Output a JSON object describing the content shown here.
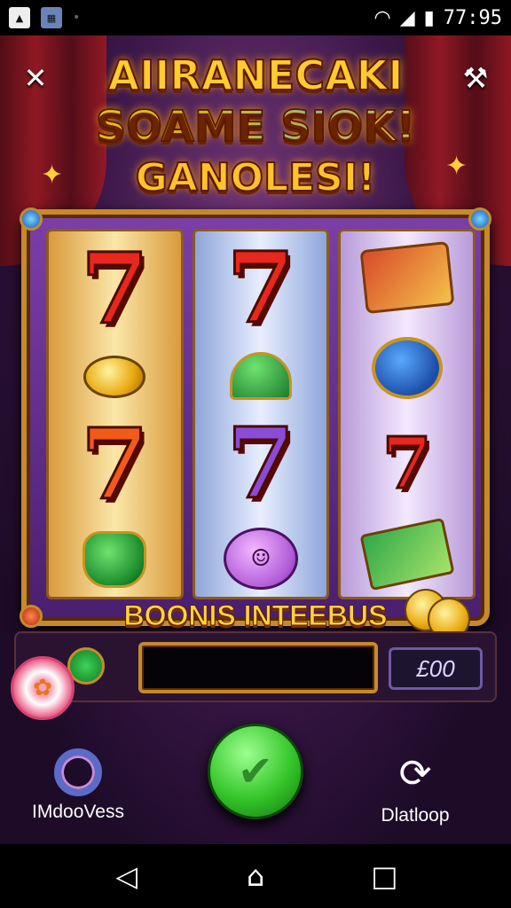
{
  "status_bar": {
    "time": "77:95",
    "left_icons": [
      "photo-icon",
      "gallery-icon"
    ],
    "right_icons": [
      "wifi-icon",
      "signal-icon",
      "battery-icon"
    ]
  },
  "game": {
    "title_lines": [
      "AIIRANECAKI",
      "SOAME SIOK!",
      "GANOLESI!"
    ],
    "bonus_label": "BOONIS INTEEBUS",
    "credit_display": "£00",
    "bet_bar_value": "",
    "reels": [
      [
        "seven-red",
        "coin",
        "seven-orange",
        "green-pot"
      ],
      [
        "seven-red",
        "green-helmet",
        "seven-purple",
        "purple-blob"
      ],
      [
        "ticket",
        "blue-badge",
        "seven-red-small",
        "cash-card"
      ]
    ],
    "colors": {
      "accent_gold": "#c58b2a",
      "spin_green": "#35c52a",
      "title_yellow": "#ffcc2e"
    }
  },
  "bottom": {
    "left_label": "IMdooVess",
    "right_label": "Dlatloop",
    "left_icon": "ring-icon",
    "right_icon": "counter-icon",
    "spin_icon": "check-icon"
  },
  "system_nav": [
    "back-icon",
    "home-icon",
    "recents-icon"
  ]
}
